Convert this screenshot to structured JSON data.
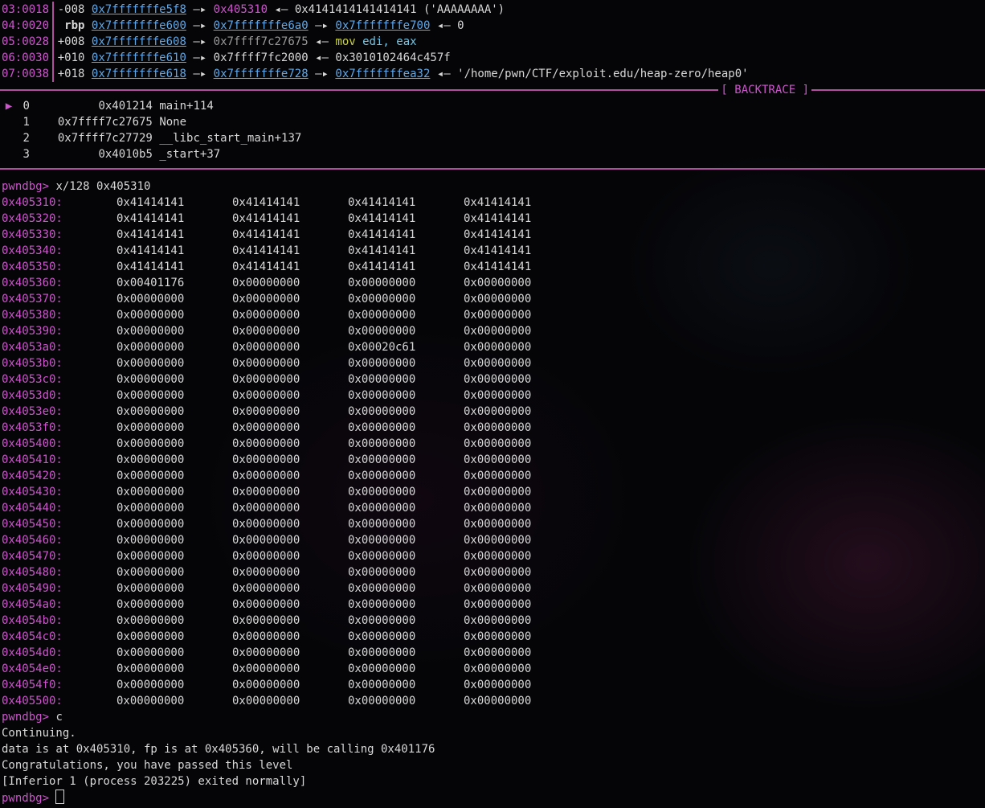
{
  "stack": [
    {
      "idx": "03:0018",
      "off": "-008",
      "reg": "",
      "addr": "0x7fffffffe5f8",
      "chain": [
        {
          "arrow": "—▸",
          "val": "0x405310",
          "style": "mag"
        },
        {
          "arrow": "◂—",
          "val": "0x4141414141414141 ('AAAAAAAA')",
          "style": "wht"
        }
      ]
    },
    {
      "idx": "04:0020",
      "off": "",
      "reg": "rbp",
      "addr": "0x7fffffffe600",
      "chain": [
        {
          "arrow": "—▸",
          "val": "0x7fffffffe6a0",
          "style": "lnk"
        },
        {
          "arrow": "—▸",
          "val": "0x7fffffffe700",
          "style": "lnk"
        },
        {
          "arrow": "◂—",
          "val": "0",
          "style": "wht"
        }
      ]
    },
    {
      "idx": "05:0028",
      "off": "+008",
      "reg": "",
      "addr": "0x7fffffffe608",
      "chain": [
        {
          "arrow": "—▸",
          "val": "0x7ffff7c27675",
          "style": "grey"
        },
        {
          "arrow": "◂—",
          "val": "",
          "style": "asm",
          "mnem": "mov",
          "ops": "edi, eax"
        }
      ]
    },
    {
      "idx": "06:0030",
      "off": "+010",
      "reg": "",
      "addr": "0x7fffffffe610",
      "chain": [
        {
          "arrow": "—▸",
          "val": "0x7ffff7fc2000",
          "style": "wht"
        },
        {
          "arrow": "◂—",
          "val": "0x3010102464c457f",
          "style": "wht"
        }
      ]
    },
    {
      "idx": "07:0038",
      "off": "+018",
      "reg": "",
      "addr": "0x7fffffffe618",
      "chain": [
        {
          "arrow": "—▸",
          "val": "0x7fffffffe728",
          "style": "lnk"
        },
        {
          "arrow": "—▸",
          "val": "0x7fffffffea32",
          "style": "lnk"
        },
        {
          "arrow": "◂—",
          "val": "'/home/pwn/CTF/exploit.edu/heap-zero/heap0'",
          "style": "wht"
        }
      ]
    }
  ],
  "backtrace_title": "[ BACKTRACE ]",
  "backtrace": [
    {
      "marker": "▶",
      "num": "0",
      "addr": "0x401214",
      "sym": "main+114"
    },
    {
      "marker": "",
      "num": "1",
      "addr": "0x7ffff7c27675",
      "sym": "None"
    },
    {
      "marker": "",
      "num": "2",
      "addr": "0x7ffff7c27729",
      "sym": "__libc_start_main+137"
    },
    {
      "marker": "",
      "num": "3",
      "addr": "0x4010b5",
      "sym": "_start+37"
    }
  ],
  "prompt": "pwndbg>",
  "examine_cmd": "x/128 0x405310",
  "memory": [
    {
      "a": "0x405310:",
      "w": [
        "0x41414141",
        "0x41414141",
        "0x41414141",
        "0x41414141"
      ]
    },
    {
      "a": "0x405320:",
      "w": [
        "0x41414141",
        "0x41414141",
        "0x41414141",
        "0x41414141"
      ]
    },
    {
      "a": "0x405330:",
      "w": [
        "0x41414141",
        "0x41414141",
        "0x41414141",
        "0x41414141"
      ]
    },
    {
      "a": "0x405340:",
      "w": [
        "0x41414141",
        "0x41414141",
        "0x41414141",
        "0x41414141"
      ]
    },
    {
      "a": "0x405350:",
      "w": [
        "0x41414141",
        "0x41414141",
        "0x41414141",
        "0x41414141"
      ]
    },
    {
      "a": "0x405360:",
      "w": [
        "0x00401176",
        "0x00000000",
        "0x00000000",
        "0x00000000"
      ]
    },
    {
      "a": "0x405370:",
      "w": [
        "0x00000000",
        "0x00000000",
        "0x00000000",
        "0x00000000"
      ]
    },
    {
      "a": "0x405380:",
      "w": [
        "0x00000000",
        "0x00000000",
        "0x00000000",
        "0x00000000"
      ]
    },
    {
      "a": "0x405390:",
      "w": [
        "0x00000000",
        "0x00000000",
        "0x00000000",
        "0x00000000"
      ]
    },
    {
      "a": "0x4053a0:",
      "w": [
        "0x00000000",
        "0x00000000",
        "0x00020c61",
        "0x00000000"
      ]
    },
    {
      "a": "0x4053b0:",
      "w": [
        "0x00000000",
        "0x00000000",
        "0x00000000",
        "0x00000000"
      ]
    },
    {
      "a": "0x4053c0:",
      "w": [
        "0x00000000",
        "0x00000000",
        "0x00000000",
        "0x00000000"
      ]
    },
    {
      "a": "0x4053d0:",
      "w": [
        "0x00000000",
        "0x00000000",
        "0x00000000",
        "0x00000000"
      ]
    },
    {
      "a": "0x4053e0:",
      "w": [
        "0x00000000",
        "0x00000000",
        "0x00000000",
        "0x00000000"
      ]
    },
    {
      "a": "0x4053f0:",
      "w": [
        "0x00000000",
        "0x00000000",
        "0x00000000",
        "0x00000000"
      ]
    },
    {
      "a": "0x405400:",
      "w": [
        "0x00000000",
        "0x00000000",
        "0x00000000",
        "0x00000000"
      ]
    },
    {
      "a": "0x405410:",
      "w": [
        "0x00000000",
        "0x00000000",
        "0x00000000",
        "0x00000000"
      ]
    },
    {
      "a": "0x405420:",
      "w": [
        "0x00000000",
        "0x00000000",
        "0x00000000",
        "0x00000000"
      ]
    },
    {
      "a": "0x405430:",
      "w": [
        "0x00000000",
        "0x00000000",
        "0x00000000",
        "0x00000000"
      ]
    },
    {
      "a": "0x405440:",
      "w": [
        "0x00000000",
        "0x00000000",
        "0x00000000",
        "0x00000000"
      ]
    },
    {
      "a": "0x405450:",
      "w": [
        "0x00000000",
        "0x00000000",
        "0x00000000",
        "0x00000000"
      ]
    },
    {
      "a": "0x405460:",
      "w": [
        "0x00000000",
        "0x00000000",
        "0x00000000",
        "0x00000000"
      ]
    },
    {
      "a": "0x405470:",
      "w": [
        "0x00000000",
        "0x00000000",
        "0x00000000",
        "0x00000000"
      ]
    },
    {
      "a": "0x405480:",
      "w": [
        "0x00000000",
        "0x00000000",
        "0x00000000",
        "0x00000000"
      ]
    },
    {
      "a": "0x405490:",
      "w": [
        "0x00000000",
        "0x00000000",
        "0x00000000",
        "0x00000000"
      ]
    },
    {
      "a": "0x4054a0:",
      "w": [
        "0x00000000",
        "0x00000000",
        "0x00000000",
        "0x00000000"
      ]
    },
    {
      "a": "0x4054b0:",
      "w": [
        "0x00000000",
        "0x00000000",
        "0x00000000",
        "0x00000000"
      ]
    },
    {
      "a": "0x4054c0:",
      "w": [
        "0x00000000",
        "0x00000000",
        "0x00000000",
        "0x00000000"
      ]
    },
    {
      "a": "0x4054d0:",
      "w": [
        "0x00000000",
        "0x00000000",
        "0x00000000",
        "0x00000000"
      ]
    },
    {
      "a": "0x4054e0:",
      "w": [
        "0x00000000",
        "0x00000000",
        "0x00000000",
        "0x00000000"
      ]
    },
    {
      "a": "0x4054f0:",
      "w": [
        "0x00000000",
        "0x00000000",
        "0x00000000",
        "0x00000000"
      ]
    },
    {
      "a": "0x405500:",
      "w": [
        "0x00000000",
        "0x00000000",
        "0x00000000",
        "0x00000000"
      ]
    }
  ],
  "continue_cmd": "c",
  "output": [
    "Continuing.",
    "data is at 0x405310, fp is at 0x405360, will be calling 0x401176",
    "Congratulations, you have passed this level",
    "[Inferior 1 (process 203225) exited normally]"
  ]
}
